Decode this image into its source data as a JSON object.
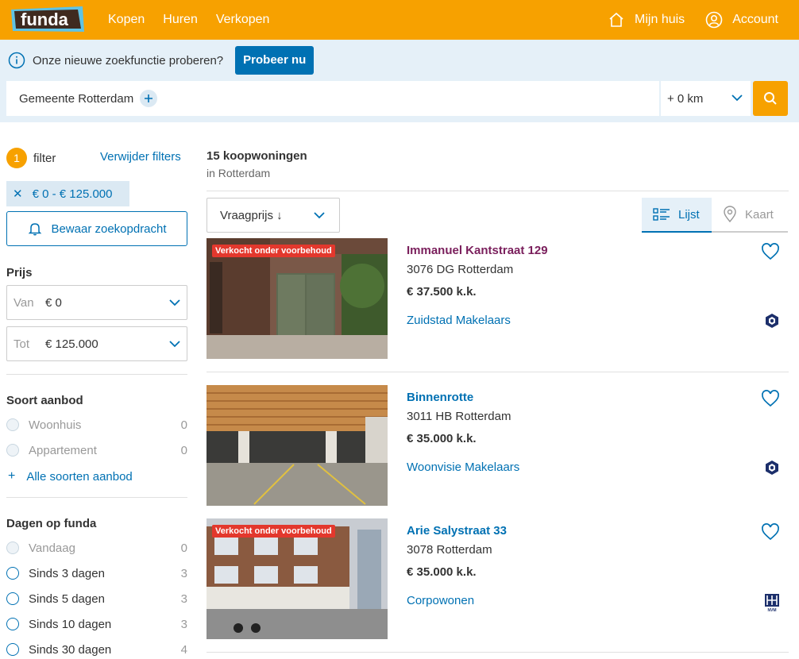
{
  "header": {
    "logo_text": "funda",
    "nav": [
      "Kopen",
      "Huren",
      "Verkopen"
    ],
    "my_house": "Mijn huis",
    "account": "Account"
  },
  "search": {
    "try_text": "Onze nieuwe zoekfunctie proberen?",
    "try_button": "Probeer nu",
    "location": "Gemeente Rotterdam",
    "distance": "+ 0 km"
  },
  "sidebar": {
    "filter_count": "1",
    "filter_label": "filter",
    "remove_filters": "Verwijder filters",
    "active_chip": "€ 0 - € 125.000",
    "save_search": "Bewaar zoekopdracht",
    "price": {
      "title": "Prijs",
      "from_label": "Van",
      "from_value": "€ 0",
      "to_label": "Tot",
      "to_value": "€ 125.000"
    },
    "offer_type": {
      "title": "Soort aanbod",
      "options": [
        {
          "label": "Woonhuis",
          "count": "0"
        },
        {
          "label": "Appartement",
          "count": "0"
        }
      ],
      "more": "Alle soorten aanbod"
    },
    "days": {
      "title": "Dagen op funda",
      "options": [
        {
          "label": "Vandaag",
          "count": "0"
        },
        {
          "label": "Sinds 3 dagen",
          "count": "3"
        },
        {
          "label": "Sinds 5 dagen",
          "count": "3"
        },
        {
          "label": "Sinds 10 dagen",
          "count": "3"
        },
        {
          "label": "Sinds 30 dagen",
          "count": "4"
        }
      ]
    }
  },
  "results": {
    "count": "15 koopwoningen",
    "where": "in Rotterdam",
    "sort": "Vraagprijs ↓",
    "view_list": "Lijst",
    "view_map": "Kaart",
    "listings": [
      {
        "address": "Immanuel Kantstraat 129",
        "city": "3076 DG Rotterdam",
        "price": "€ 37.500 k.k.",
        "agent": "Zuidstad Makelaars",
        "tag": "Verkocht onder voorbehoud",
        "agent_logo": "vbo-logo"
      },
      {
        "address": "Binnenrotte",
        "city": "3011 HB Rotterdam",
        "price": "€ 35.000 k.k.",
        "agent": "Woonvisie Makelaars",
        "tag": "",
        "agent_logo": "vbo-logo"
      },
      {
        "address": "Arie Salystraat 33",
        "city": "3078 Rotterdam",
        "price": "€ 35.000 k.k.",
        "agent": "Corpowonen",
        "tag": "Verkocht onder voorbehoud",
        "agent_logo": "nvm-logo"
      }
    ]
  },
  "colors": {
    "brand_orange": "#f7a100",
    "link_blue": "#0071b3",
    "sold_red": "#e3382d"
  }
}
